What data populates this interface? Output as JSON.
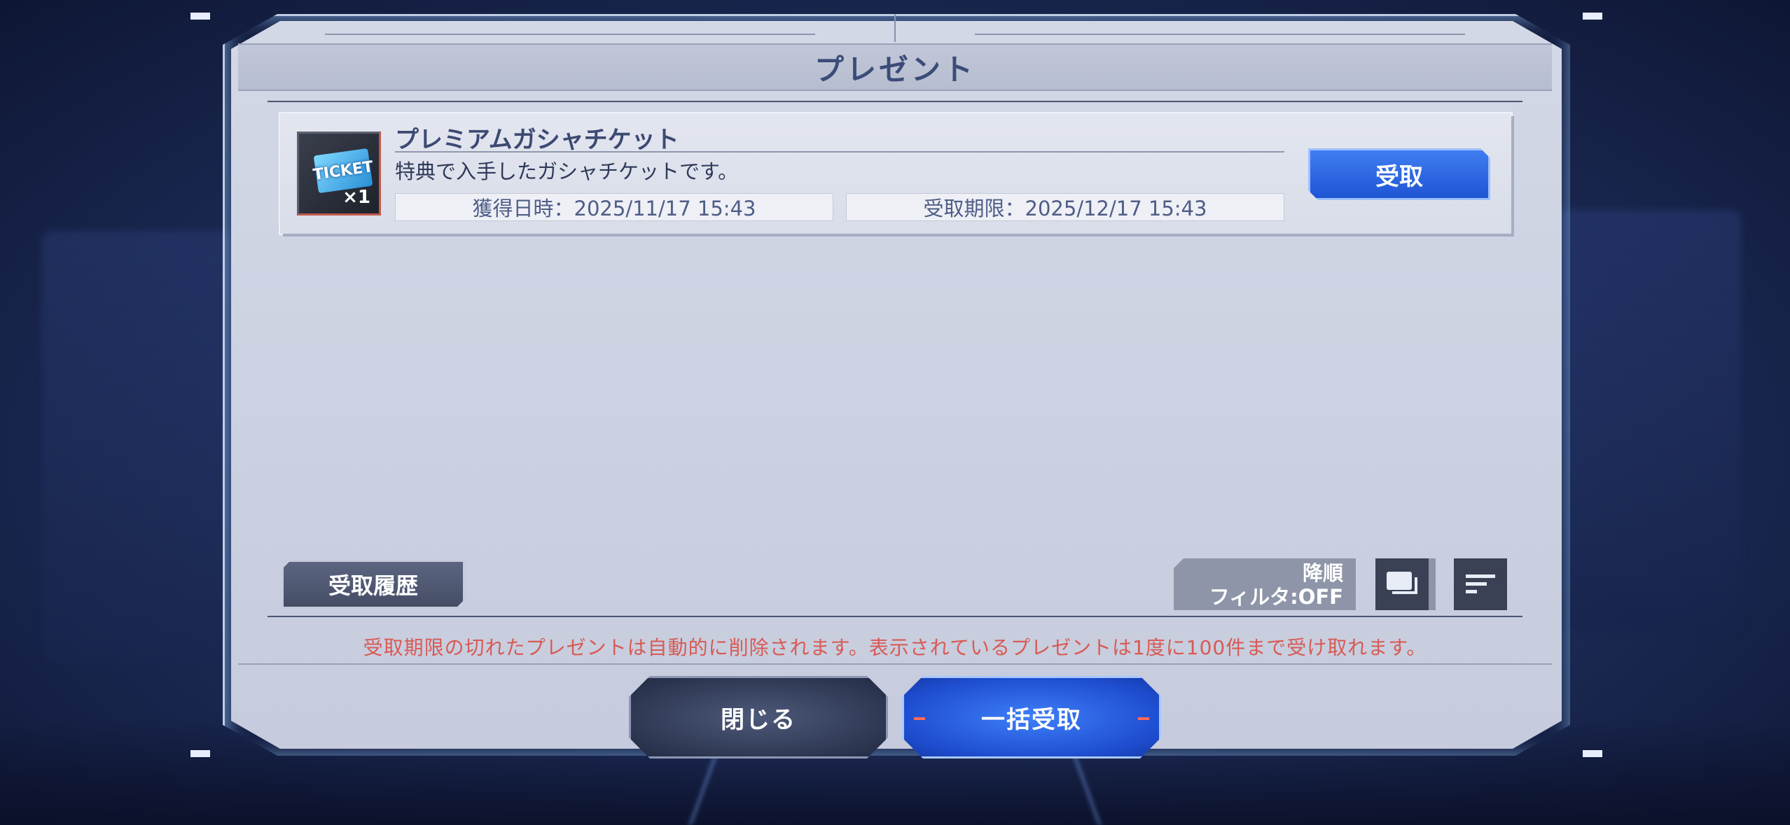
{
  "dialog": {
    "title": "プレゼント"
  },
  "presents": [
    {
      "name": "プレミアムガシャチケット",
      "description": "特典で入手したガシャチケットです。",
      "icon": "ticket-icon",
      "icon_text": "TICKET",
      "quantity": "×1",
      "acquired": "獲得日時：2025/11/17 15:43",
      "deadline": "受取期限：2025/12/17 15:43",
      "receive_label": "受取"
    }
  ],
  "controls": {
    "history_label": "受取履歴",
    "sort_label": "降順",
    "filter_label": "フィルタ:OFF",
    "filter_icon": "filter-window-icon",
    "sort_icon": "sort-lines-icon"
  },
  "notice": "受取期限の切れたプレゼントは自動的に削除されます。表示されているプレゼントは1度に100件まで受け取れます。",
  "buttons": {
    "close_label": "閉じる",
    "receive_all_label": "一括受取"
  },
  "colors": {
    "accent_blue": "#1f55d4",
    "notice_red": "#d85a55",
    "title_text": "#3b4c78"
  }
}
